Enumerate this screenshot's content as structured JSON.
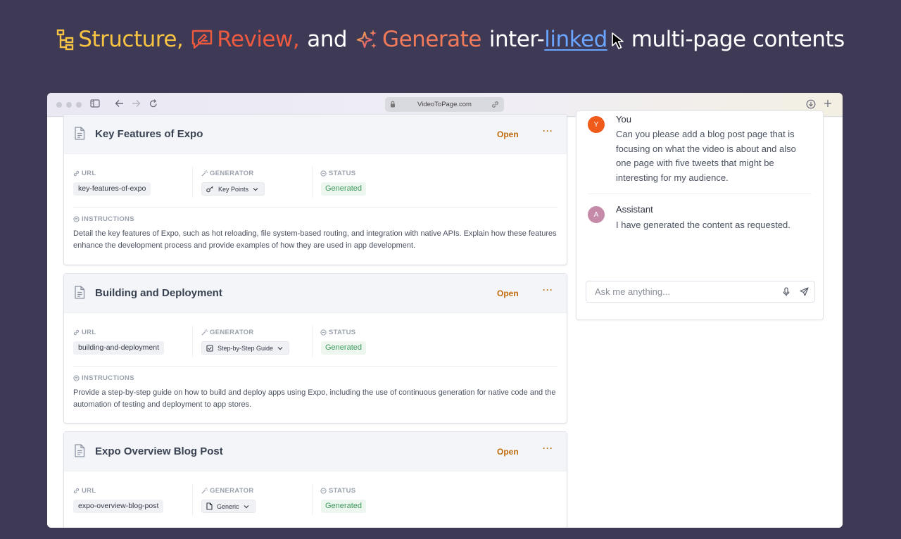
{
  "headline": {
    "structure": "Structure,",
    "review": "Review,",
    "and": "and",
    "generate": "Generate",
    "inter": "inter-",
    "linked": "linked",
    "rest": "multi-page contents"
  },
  "browser": {
    "address": "VideoToPage.com"
  },
  "labels": {
    "url": "URL",
    "generator": "GENERATOR",
    "status": "STATUS",
    "instructions": "INSTRUCTIONS",
    "open": "Open",
    "more": "···"
  },
  "cards": [
    {
      "title": "Key Features of Expo",
      "url": "key-features-of-expo",
      "generator": "Key Points",
      "generator_icon": "key-icon",
      "status": "Generated",
      "instructions": "Detail the key features of Expo, such as hot reloading, file system-based routing, and integration with native APIs. Explain how these features enhance the development process and provide examples of how they are used in app development."
    },
    {
      "title": "Building and Deployment",
      "url": "building-and-deployment",
      "generator": "Step-by-Step Guide",
      "generator_icon": "checkbox-icon",
      "status": "Generated",
      "instructions": "Provide a step-by-step guide on how to build and deploy apps using Expo, including the use of continuous generation for native code and the automation of testing and deployment to app stores."
    },
    {
      "title": "Expo Overview Blog Post",
      "url": "expo-overview-blog-post",
      "generator": "Generic",
      "generator_icon": "file-icon",
      "status": "Generated"
    }
  ],
  "chat": {
    "messages": [
      {
        "author": "You",
        "avatar": "Y",
        "text": "Can you please add a blog post page that is focusing on what the video is about and also one page with five tweets that might be interesting for my audience."
      },
      {
        "author": "Assistant",
        "avatar": "A",
        "text": "I have generated the content as requested."
      }
    ],
    "placeholder": "Ask me anything..."
  },
  "colors": {
    "background": "#3e3a55",
    "structure": "#f6c342",
    "review": "#ee5a40",
    "generate": "#f07a5a",
    "linked": "#6aa5ff",
    "accent_open": "#c06a0c",
    "status_green": "#3c9a5b",
    "avatar_user": "#f05a1a",
    "avatar_assistant": "#c48aa8"
  }
}
